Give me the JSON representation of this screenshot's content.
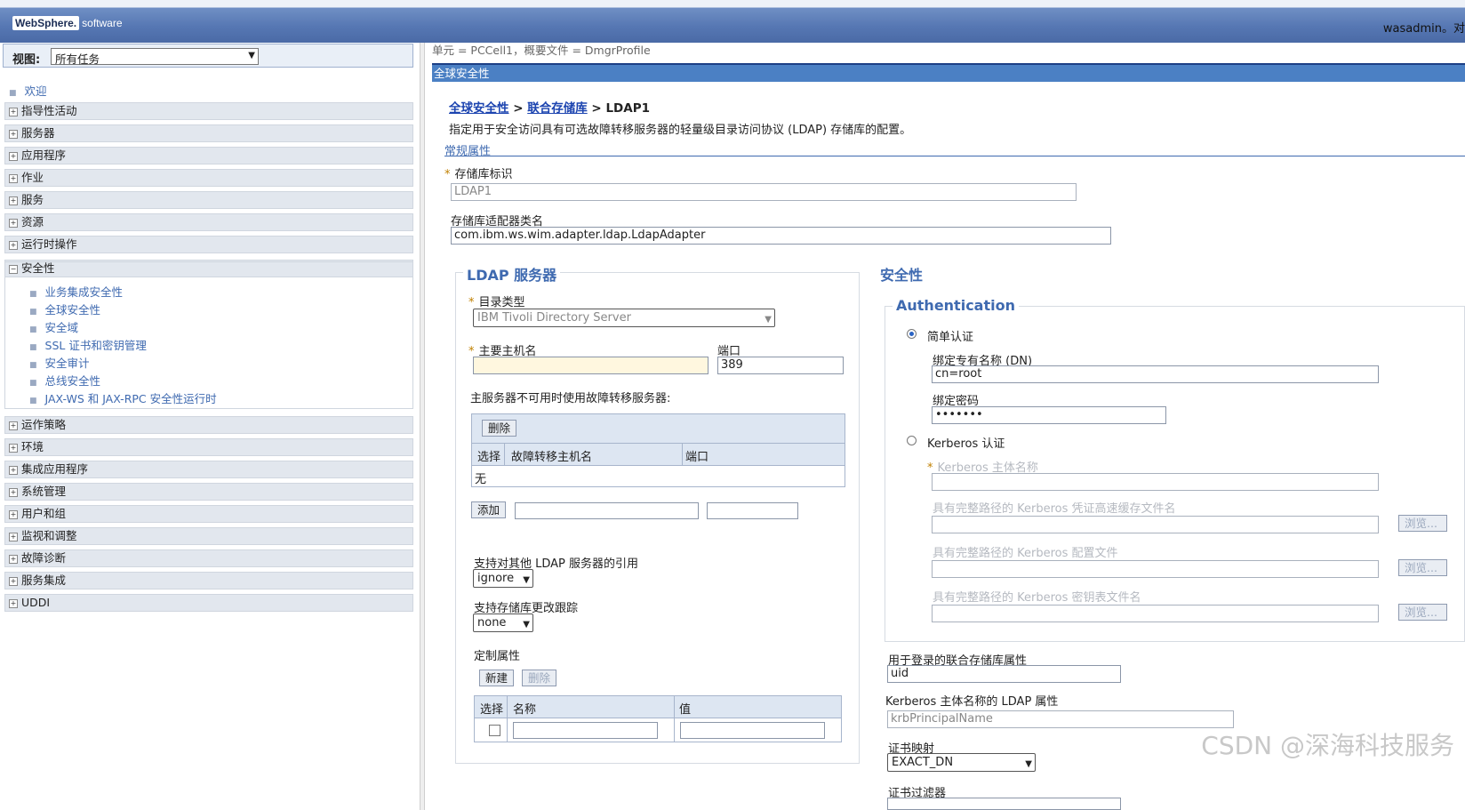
{
  "header": {
    "logo_brand": "WebSphere.",
    "logo_suffix": "software",
    "user": "wasadmin。对"
  },
  "nav": {
    "view_label": "视图:",
    "view_value": "所有任务",
    "welcome": "欢迎",
    "categories": [
      "指导性活动",
      "服务器",
      "应用程序",
      "作业",
      "服务",
      "资源",
      "运行时操作",
      "安全性"
    ],
    "security_items": [
      "业务集成安全性",
      "全球安全性",
      "安全域",
      "SSL 证书和密钥管理",
      "安全审计",
      "总线安全性",
      "JAX-WS 和 JAX-RPC 安全性运行时"
    ],
    "categories_after": [
      "运作策略",
      "环境",
      "集成应用程序",
      "系统管理",
      "用户和组",
      "监视和调整",
      "故障诊断",
      "服务集成",
      "UDDI"
    ]
  },
  "main": {
    "scope": "单元 = PCCell1，概要文件 = DmgrProfile",
    "panel_title": "全球安全性",
    "breadcrumb": {
      "link1": "全球安全性",
      "sep": ">",
      "link2": "联合存储库",
      "current": "LDAP1"
    },
    "description": "指定用于安全访问具有可选故障转移服务器的轻量级目录访问协议 (LDAP) 存储库的配置。",
    "general_properties": "常规属性",
    "repo_id_label": "存储库标识",
    "repo_id_value": "LDAP1",
    "adapter_label": "存储库适配器类名",
    "adapter_value": "com.ibm.ws.wim.adapter.ldap.LdapAdapter"
  },
  "ldap": {
    "legend": "LDAP 服务器",
    "dir_type_label": "目录类型",
    "dir_type_value": "IBM Tivoli Directory Server",
    "host_label": "主要主机名",
    "host_value": "",
    "port_label": "端口",
    "port_value": "389",
    "failover_label": "主服务器不可用时使用故障转移服务器:",
    "delete_button": "删除",
    "col_select": "选择",
    "col_host": "故障转移主机名",
    "col_port": "端口",
    "none_row": "无",
    "add_button": "添加",
    "referral_label": "支持对其他 LDAP 服务器的引用",
    "referral_value": "ignore",
    "change_tracking_label": "支持存储库更改跟踪",
    "change_tracking_value": "none",
    "custom_props_label": "定制属性",
    "new_button": "新建",
    "delete2_button": "删除",
    "col_select2": "选择",
    "col_name": "名称",
    "col_value": "值"
  },
  "security": {
    "legend": "安全性",
    "auth_legend": "Authentication",
    "simple_auth": "简单认证",
    "bind_dn_label": "绑定专有名称 (DN)",
    "bind_dn_value": "cn=root",
    "bind_pw_label": "绑定密码",
    "bind_pw_value": "•••••••",
    "kerberos_auth": "Kerberos 认证",
    "kerberos_principal": "Kerberos 主体名称",
    "kerberos_cache": "具有完整路径的 Kerberos 凭证高速缓存文件名",
    "kerberos_config": "具有完整路径的 Kerberos 配置文件",
    "kerberos_keytab": "具有完整路径的 Kerberos 密钥表文件名",
    "browse": "浏览...",
    "login_prop_label": "用于登录的联合存储库属性",
    "login_prop_value": "uid",
    "krb_ldap_label": "Kerberos 主体名称的 LDAP 属性",
    "krb_ldap_value": "krbPrincipalName",
    "cert_map_label": "证书映射",
    "cert_map_value": "EXACT_DN",
    "cert_filter_label": "证书过滤器"
  },
  "watermark": "CSDN @深海科技服务"
}
